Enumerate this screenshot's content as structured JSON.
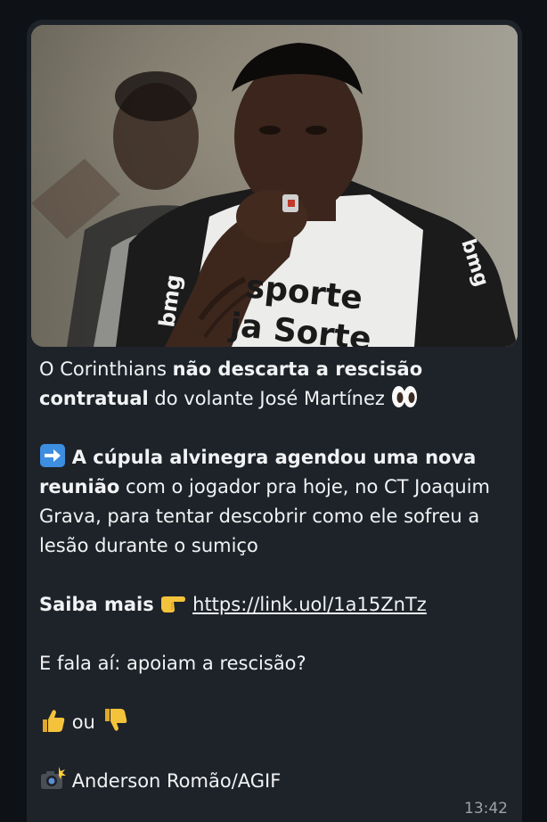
{
  "post": {
    "line1_prefix": "O Corinthians ",
    "line1_bold": "não descarta a rescisão contratual",
    "line1_suffix": " do volante José Martínez",
    "para2_bold": "A cúpula alvinegra agendou uma nova reunião",
    "para2_text": " com o jogador pra hoje, no CT Joaquim Grava, para tentar descobrir como ele sofreu a lesão durante o sumiço",
    "saiba_label": "Saiba mais",
    "link": "https://link.uol/1a15ZnTz",
    "question": "E fala aí: apoiam a rescisão?",
    "or_word": "ou",
    "credit": "Anderson Romão/AGIF",
    "time": "13:42"
  },
  "photo": {
    "shirt_sponsor_line1": "sporte",
    "shirt_sponsor_line2": "ja Sorte",
    "sleeve_sponsor": "bmg",
    "sleeve_sponsor_right": "bmg"
  },
  "icons": [
    "eyes-icon",
    "right-arrow-icon",
    "point-right-icon",
    "thumbs-up-icon",
    "thumbs-down-icon",
    "camera-flash-icon"
  ]
}
